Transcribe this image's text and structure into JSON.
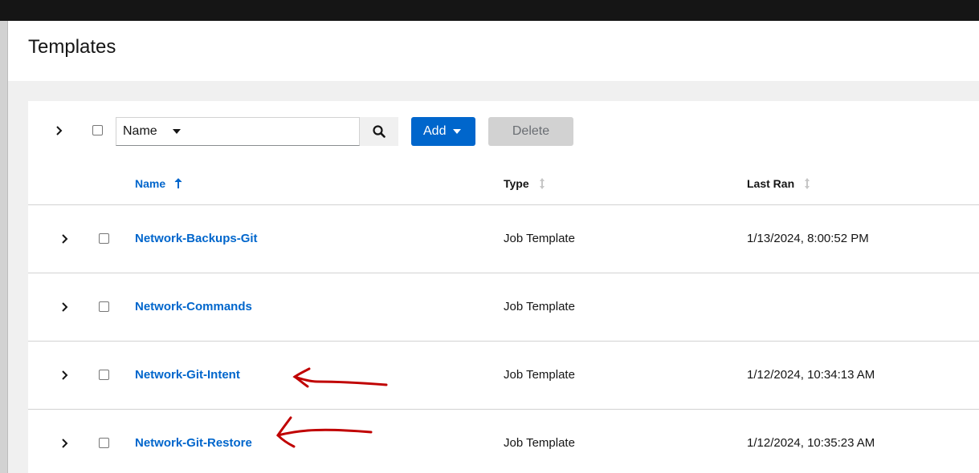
{
  "page": {
    "title": "Templates"
  },
  "toolbar": {
    "filter_select": "Name",
    "search_placeholder": "",
    "add_label": "Add",
    "delete_label": "Delete"
  },
  "table": {
    "columns": {
      "name": "Name",
      "type": "Type",
      "last_ran": "Last Ran"
    },
    "rows": [
      {
        "name": "Network-Backups-Git",
        "type": "Job Template",
        "last_ran": "1/13/2024, 8:00:52 PM"
      },
      {
        "name": "Network-Commands",
        "type": "Job Template",
        "last_ran": ""
      },
      {
        "name": "Network-Git-Intent",
        "type": "Job Template",
        "last_ran": "1/12/2024, 10:34:13 AM"
      },
      {
        "name": "Network-Git-Restore",
        "type": "Job Template",
        "last_ran": "1/12/2024, 10:35:23 AM"
      }
    ]
  },
  "colors": {
    "link": "#0066cc",
    "primary": "#0066cc",
    "annotation": "#c00000"
  }
}
